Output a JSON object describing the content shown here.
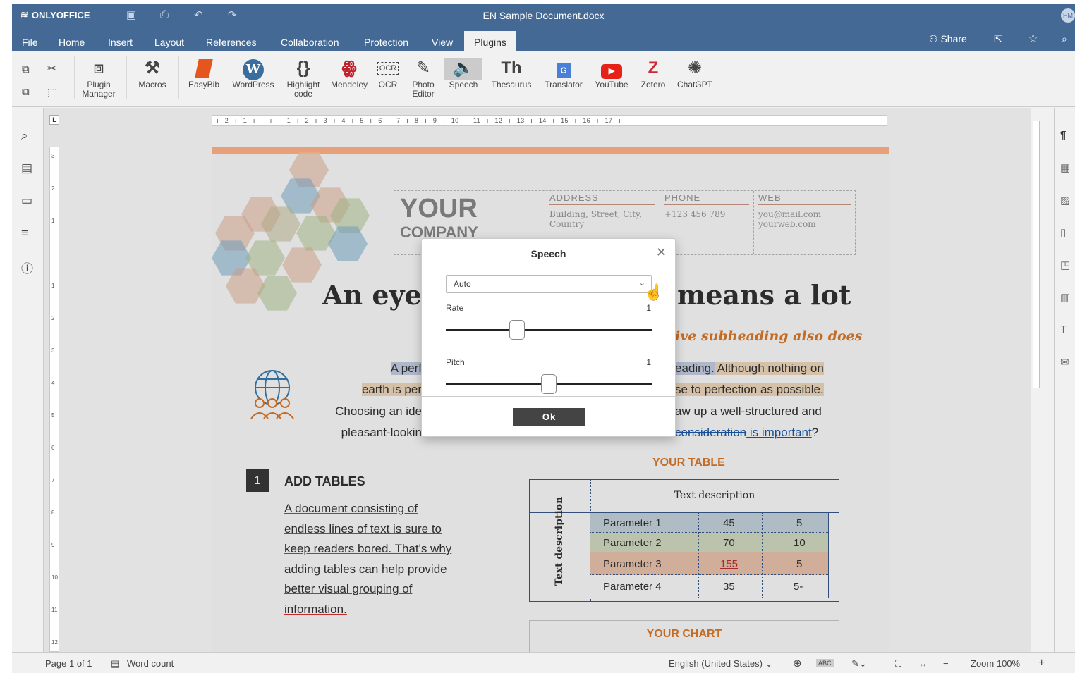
{
  "app": {
    "name": "ONLYOFFICE",
    "doc_title": "EN Sample Document.docx",
    "avatar": "HM"
  },
  "menu": {
    "tabs": [
      "File",
      "Home",
      "Insert",
      "Layout",
      "References",
      "Collaboration",
      "Protection",
      "View",
      "Plugins"
    ],
    "active": "Plugins",
    "share": "Share"
  },
  "toolbar": {
    "plugins": [
      {
        "id": "plugin-manager",
        "label": "Plugin Manager",
        "icon": "puzzle-icon"
      },
      {
        "id": "macros",
        "label": "Macros",
        "icon": "tools-icon"
      },
      {
        "id": "easybib",
        "label": "EasyBib",
        "icon": "easybib-icon"
      },
      {
        "id": "wordpress",
        "label": "WordPress",
        "icon": "wordpress-icon"
      },
      {
        "id": "highlight-code",
        "label": "Highlight code",
        "icon": "braces-icon"
      },
      {
        "id": "mendeley",
        "label": "Mendeley",
        "icon": "mendeley-icon"
      },
      {
        "id": "ocr",
        "label": "OCR",
        "icon": "ocr-icon"
      },
      {
        "id": "photo-editor",
        "label": "Photo Editor",
        "icon": "photo-editor-icon"
      },
      {
        "id": "speech",
        "label": "Speech",
        "icon": "speaker-icon"
      },
      {
        "id": "thesaurus",
        "label": "Thesaurus",
        "icon": "thesaurus-icon"
      },
      {
        "id": "translator",
        "label": "Translator",
        "icon": "translate-icon"
      },
      {
        "id": "youtube",
        "label": "YouTube",
        "icon": "youtube-icon"
      },
      {
        "id": "zotero",
        "label": "Zotero",
        "icon": "zotero-icon"
      },
      {
        "id": "chatgpt",
        "label": "ChatGPT",
        "icon": "chatgpt-icon"
      }
    ]
  },
  "ruler": {
    "h_text": "· ı · 2 · ı · 1 · ı · · · ı · · · 1 · ı · 2 · ı · 3 · ı · 4 · ı · 5 · ı · 6 · ı · 7 · ı · 8 · ı · 9 · ı · 10 · ı · 11 · ı · 12 · ı · 13 · ı · 14 · ı · 15 · ı · 16 · ı · 17 · ı ·",
    "v_marks": [
      "3",
      "2",
      "1",
      "1",
      "2",
      "3",
      "4",
      "5",
      "6",
      "7",
      "8",
      "9",
      "10",
      "11",
      "12"
    ]
  },
  "document": {
    "company_line1": "YOUR",
    "company_line2": "COMPANY",
    "address": {
      "header": "ADDRESS",
      "text": "Building, Street, City, Country"
    },
    "phone": {
      "header": "PHONE",
      "text": "+123 456 789"
    },
    "web": {
      "header": "WEB",
      "text1": "you@mail.com",
      "text2": "yourweb.com"
    },
    "heading_left": "An eye-",
    "heading_right": "means a lot",
    "subheading_right": "ive subheading also does",
    "p1_left": "A perf",
    "p1_right_hl": "eading.",
    "p1_right": " Although nothing on",
    "p2_left": "earth is per",
    "p2_right": "se to perfection as possible.",
    "p3_left": "Choosing an ide",
    "p3_right": "aw up a well-structured and",
    "p4_left": "pleasant-lookin",
    "p4_strike": "consideration",
    "p4_link": " is important",
    "p4_end": "?",
    "section_num": "1",
    "section_title": "ADD TABLES",
    "body_lines": [
      "A document consisting of",
      "endless lines of text is sure to",
      "keep readers bored. That's why",
      "adding tables can help provide",
      "better visual grouping of",
      "information."
    ],
    "table_title": "YOUR TABLE",
    "table_header": "Text description",
    "table_side": "Text description",
    "table_rows": [
      {
        "name": "Parameter 1",
        "a": "45",
        "b": "5",
        "color": "#c9d6df"
      },
      {
        "name": "Parameter 2",
        "a": "70",
        "b": "10",
        "color": "#d5dfc4"
      },
      {
        "name": "Parameter 3",
        "a": "155",
        "b": "5",
        "color": "#edc6b0"
      },
      {
        "name": "Parameter 4",
        "a": "35",
        "b": "5-",
        "color": "#ffffff"
      }
    ],
    "chart_title": "YOUR CHART"
  },
  "status": {
    "page": "Page 1 of 1",
    "word_count": "Word count",
    "language": "English (United States)",
    "zoom": "Zoom 100%"
  },
  "dialog": {
    "title": "Speech",
    "voice": "Auto",
    "rate_label": "Rate",
    "rate_value": "1",
    "pitch_label": "Pitch",
    "pitch_value": "1",
    "ok": "Ok"
  }
}
